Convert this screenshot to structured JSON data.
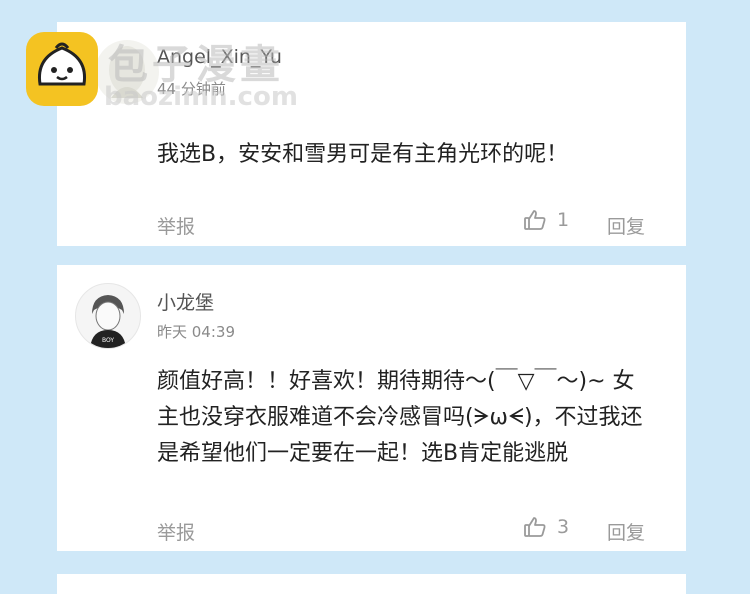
{
  "comments": [
    {
      "username": "Angel_Xin_Yu",
      "time": "44 分钟前",
      "text": "我选B，安安和雪男可是有主角光环的呢！",
      "report_label": "举报",
      "like_count": "1",
      "reply_label": "回复"
    },
    {
      "username": "小龙堡",
      "time": "昨天 04:39",
      "text": "颜值好高！！好喜欢！期待期待～(￣▽￣～)~ 女主也没穿衣服难道不会冷感冒吗(ᗒωᗕ)，不过我还是希望他们一定要在一起！选B肯定能逃脱",
      "report_label": "举报",
      "like_count": "3",
      "reply_label": "回复"
    }
  ],
  "watermark": {
    "text_cn": "包子漫畫",
    "text_en": "baozimh.com"
  },
  "colors": {
    "background": "#cfe8f8",
    "card": "#ffffff",
    "logo": "#f4c322"
  }
}
